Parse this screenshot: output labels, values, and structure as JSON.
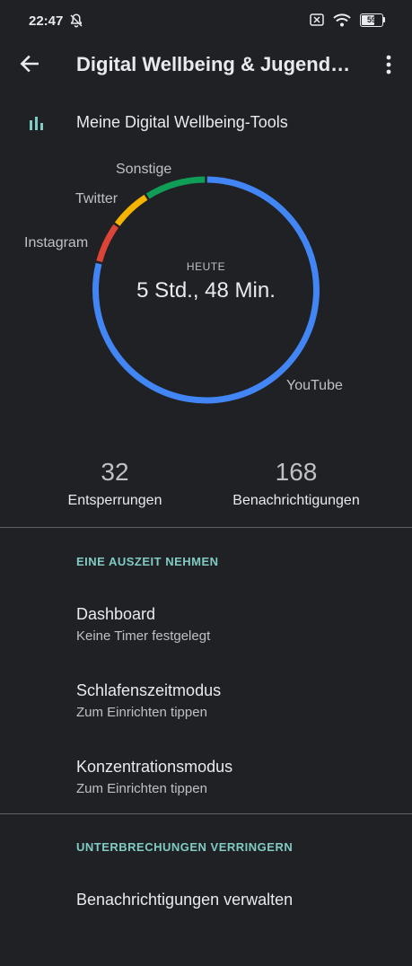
{
  "status_bar": {
    "time": "22:47",
    "battery": "59"
  },
  "app_bar": {
    "title": "Digital Wellbeing & Jugendschutz"
  },
  "tools_header": {
    "label": "Meine Digital Wellbeing-Tools"
  },
  "chart_data": {
    "type": "pie",
    "center_label": "HEUTE",
    "center_value": "5 Std., 48 Min.",
    "slices": [
      {
        "label": "YouTube",
        "value": 79,
        "color": "#4285f4"
      },
      {
        "label": "Instagram",
        "value": 6,
        "color": "#db4437"
      },
      {
        "label": "Twitter",
        "value": 6,
        "color": "#f4b400"
      },
      {
        "label": "Sonstige",
        "value": 9,
        "color": "#0f9d58"
      }
    ]
  },
  "stats": {
    "unlocks_value": "32",
    "unlocks_label": "Entsperrungen",
    "notifications_value": "168",
    "notifications_label": "Benachrichtigungen"
  },
  "sections": {
    "timeout_header": "EINE AUSZEIT NEHMEN",
    "interruptions_header": "UNTERBRECHUNGEN VERRINGERN"
  },
  "items": [
    {
      "title": "Dashboard",
      "subtitle": "Keine Timer festgelegt"
    },
    {
      "title": "Schlafenszeitmodus",
      "subtitle": "Zum Einrichten tippen"
    },
    {
      "title": "Konzentrationsmodus",
      "subtitle": "Zum Einrichten tippen"
    },
    {
      "title": "Benachrichtigungen verwalten"
    }
  ]
}
